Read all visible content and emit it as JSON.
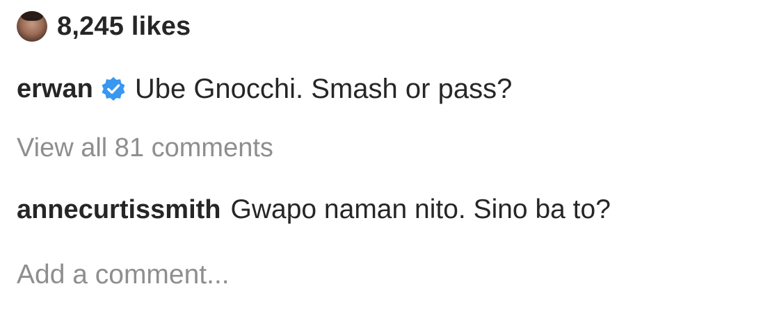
{
  "likes": {
    "count_text": "8,245 likes",
    "avatar_icon": "profile-avatar"
  },
  "caption": {
    "username": "erwan",
    "verified_icon": "verified-badge-icon",
    "verified_color": "#3897f0",
    "text": "Ube Gnocchi. Smash or pass?"
  },
  "comments": {
    "view_all_label": "View all 81 comments",
    "items": [
      {
        "username": "annecurtissmith",
        "text": "Gwapo naman nito. Sino ba to?"
      }
    ]
  },
  "add_comment": {
    "placeholder": "Add a comment..."
  },
  "colors": {
    "primary_text": "#262626",
    "secondary_text": "#8e8e8e",
    "background": "#ffffff"
  }
}
